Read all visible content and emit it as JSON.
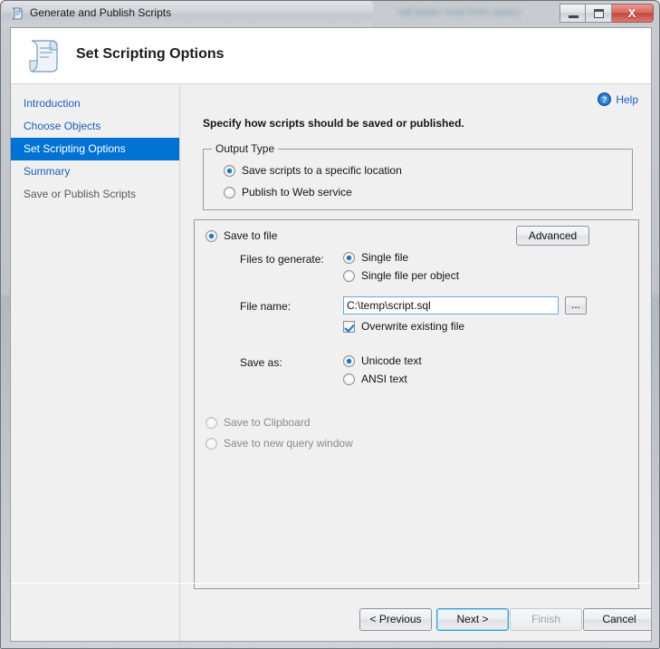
{
  "window": {
    "title": "Generate and Publish Scripts",
    "title_icon": "script-scroll-icon",
    "ghost_text": "sql tasks read from query",
    "caption": {
      "minimize_label": "Minimize",
      "maximize_label": "Restore",
      "close_label": "X"
    }
  },
  "header": {
    "title": "Set Scripting Options",
    "icon": "script-scroll-icon"
  },
  "sidebar": {
    "items": [
      {
        "label": "Introduction",
        "state": "link"
      },
      {
        "label": "Choose Objects",
        "state": "link"
      },
      {
        "label": "Set Scripting Options",
        "state": "selected"
      },
      {
        "label": "Summary",
        "state": "link"
      },
      {
        "label": "Save or Publish Scripts",
        "state": "muted"
      }
    ]
  },
  "content": {
    "help": {
      "label": "Help",
      "icon": "help-question-icon"
    },
    "instruction": "Specify how scripts should be saved or published.",
    "output_type": {
      "legend": "Output Type",
      "options": [
        {
          "label": "Save scripts to a specific location",
          "checked": true,
          "disabled": false
        },
        {
          "label": "Publish to Web service",
          "checked": false,
          "disabled": false
        }
      ]
    },
    "save_options": {
      "save_to_file": {
        "label": "Save to file",
        "checked": true
      },
      "advanced_button": "Advanced",
      "files_to_generate": {
        "label": "Files to generate:",
        "options": [
          {
            "label": "Single file",
            "checked": true
          },
          {
            "label": "Single file per object",
            "checked": false
          }
        ]
      },
      "file_name": {
        "label": "File name:",
        "value": "C:\\temp\\script.sql",
        "placeholder": "",
        "browse_button": "..."
      },
      "overwrite": {
        "label": "Overwrite existing file",
        "checked": true
      },
      "save_as": {
        "label": "Save as:",
        "options": [
          {
            "label": "Unicode text",
            "checked": true
          },
          {
            "label": "ANSI text",
            "checked": false
          }
        ]
      },
      "other_targets": [
        {
          "label": "Save to Clipboard",
          "checked": false,
          "disabled": true
        },
        {
          "label": "Save to new query window",
          "checked": false,
          "disabled": true
        }
      ]
    }
  },
  "footer": {
    "buttons": [
      {
        "label": "< Previous",
        "state": "normal"
      },
      {
        "label": "Next >",
        "state": "focused"
      },
      {
        "label": "Finish",
        "state": "disabled"
      },
      {
        "label": "Cancel",
        "state": "normal"
      }
    ]
  },
  "colors": {
    "accent_blue": "#0072d4",
    "link_blue": "#1b5fbe",
    "radio_dot": "#1878c8",
    "focus_border": "#2fa0da",
    "close_red": "#c2443c"
  }
}
